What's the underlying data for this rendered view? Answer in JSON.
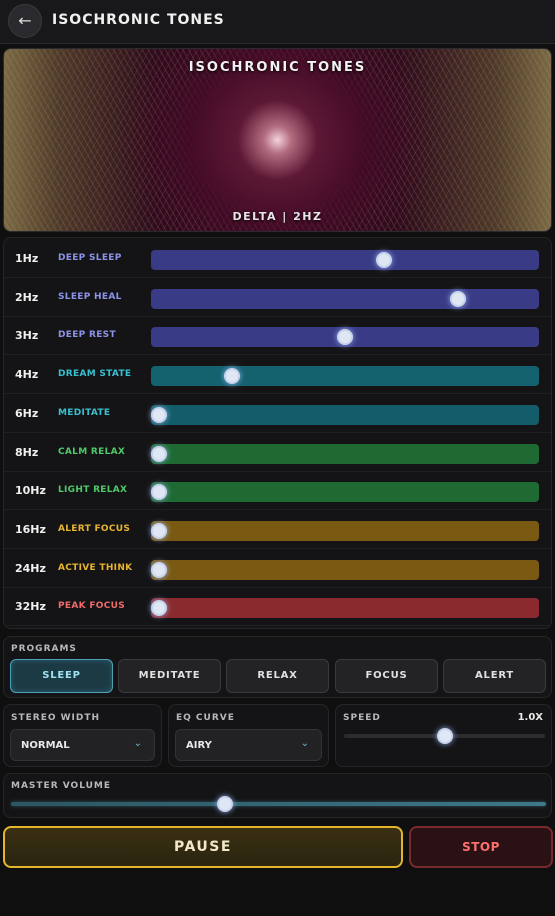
{
  "header": {
    "back_icon": "←",
    "title": "ISOCHRONIC TONES"
  },
  "visual": {
    "title": "ISOCHRONIC TONES",
    "subtitle": "DELTA | 2HZ"
  },
  "frequencies": [
    {
      "hz": "1Hz",
      "name": "DEEP SLEEP",
      "level": 0.6,
      "name_color": "#8d93e8",
      "track": "#3a3b86"
    },
    {
      "hz": "2Hz",
      "name": "SLEEP HEAL",
      "level": 0.79,
      "name_color": "#8d93e8",
      "track": "#3a3b86"
    },
    {
      "hz": "3Hz",
      "name": "DEEP REST",
      "level": 0.5,
      "name_color": "#8d93e8",
      "track": "#3a3b86"
    },
    {
      "hz": "4Hz",
      "name": "DREAM STATE",
      "level": 0.21,
      "name_color": "#38c0cf",
      "track": "#14626e"
    },
    {
      "hz": "6Hz",
      "name": "MEDITATE",
      "level": 0.02,
      "name_color": "#38c0cf",
      "track": "#135d6a"
    },
    {
      "hz": "8Hz",
      "name": "CALM RELAX",
      "level": 0.02,
      "name_color": "#4fc96a",
      "track": "#1e6a32"
    },
    {
      "hz": "10Hz",
      "name": "LIGHT RELAX",
      "level": 0.02,
      "name_color": "#4fc96a",
      "track": "#1e6a32"
    },
    {
      "hz": "16Hz",
      "name": "ALERT FOCUS",
      "level": 0.02,
      "name_color": "#e6b42e",
      "track": "#7a5a12"
    },
    {
      "hz": "24Hz",
      "name": "ACTIVE THINK",
      "level": 0.02,
      "name_color": "#e6b42e",
      "track": "#7a5a12"
    },
    {
      "hz": "32Hz",
      "name": "PEAK FOCUS",
      "level": 0.02,
      "name_color": "#f06a6a",
      "track": "#8a2a2e"
    }
  ],
  "programs": {
    "label": "PROGRAMS",
    "items": [
      "SLEEP",
      "MEDITATE",
      "RELAX",
      "FOCUS",
      "ALERT"
    ],
    "active_index": 0
  },
  "stereo": {
    "label": "STEREO WIDTH",
    "value": "NORMAL",
    "caret": "⌄"
  },
  "eq": {
    "label": "EQ CURVE",
    "value": "AIRY",
    "caret": "⌄"
  },
  "speed": {
    "label": "SPEED",
    "value": "1.0X",
    "level": 0.5
  },
  "volume": {
    "label": "MASTER VOLUME",
    "level": 0.4
  },
  "actions": {
    "pause": "PAUSE",
    "stop": "STOP"
  }
}
